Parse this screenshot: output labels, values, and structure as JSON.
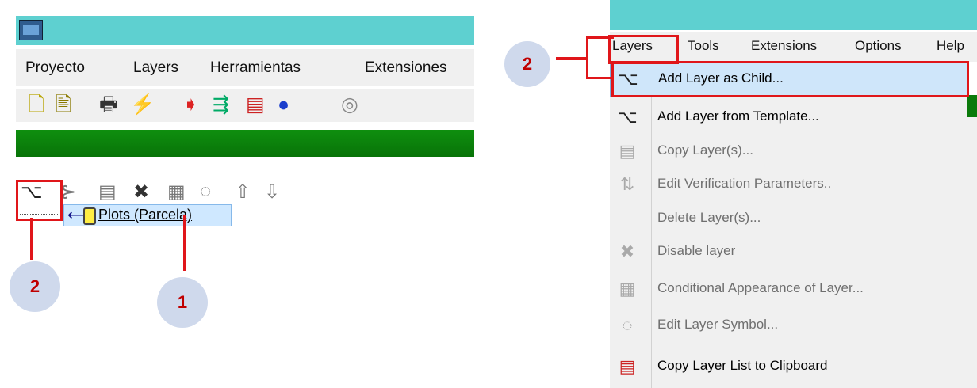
{
  "left": {
    "menu": [
      "Proyecto",
      "Layers",
      "Herramientas",
      "Extensiones"
    ],
    "tree_node_label": "Plots (Parcela)",
    "toolbar_icons": [
      "new-file-icon",
      "new-sheet-icon",
      "print-icon",
      "flash-icon",
      "export-icon",
      "transfer-icon",
      "copy-sheet-icon",
      "balls-icon",
      "target-icon"
    ],
    "tree_icons": [
      "add-child-icon",
      "remove-child-icon",
      "copy-layer-icon",
      "close-icon",
      "conditional-icon",
      "symbol-icon",
      "arrow-up-icon",
      "arrow-down-icon"
    ]
  },
  "right": {
    "menu": [
      "Layers",
      "Tools",
      "Extensions",
      "Options",
      "Help"
    ],
    "dropdown": [
      {
        "label": "Add Layer as Child...",
        "enabled": true,
        "icon": "add-child-icon"
      },
      {
        "label": "Add Layer from Template...",
        "enabled": true,
        "icon": "add-child-icon"
      },
      {
        "label": "Copy Layer(s)...",
        "enabled": false,
        "icon": "copy-layer-icon"
      },
      {
        "label": "Edit Verification Parameters..",
        "enabled": false,
        "icon": "verification-icon"
      },
      {
        "label": "Delete Layer(s)...",
        "enabled": false,
        "icon": ""
      },
      {
        "label": "Disable layer",
        "enabled": false,
        "icon": "close-icon"
      },
      {
        "label": "Conditional Appearance of Layer...",
        "enabled": false,
        "icon": "conditional-icon"
      },
      {
        "label": "Edit Layer Symbol...",
        "enabled": false,
        "icon": "symbol-icon"
      },
      {
        "label": "Copy Layer List to Clipboard",
        "enabled": true,
        "icon": "clipboard-icon"
      }
    ]
  },
  "annotations": {
    "one": "1",
    "two_a": "2",
    "two_b": "2"
  },
  "colors": {
    "accent": "#e0161a",
    "title_bar": "#5ed0d0",
    "green_bar": "#0f8f0f",
    "highlight": "#cfe6fa",
    "circle": "#cfd9ec"
  }
}
